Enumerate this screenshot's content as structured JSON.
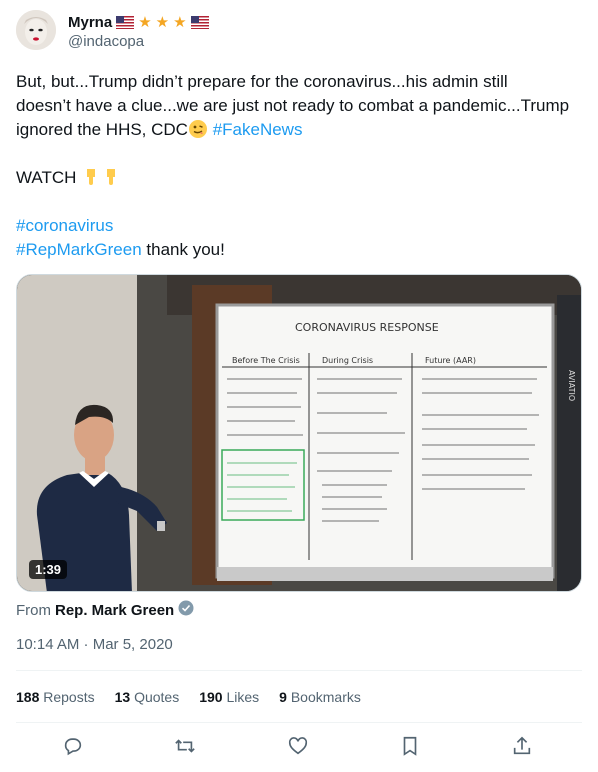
{
  "author": {
    "name": "Myrna",
    "handle": "@indacopa"
  },
  "tweet": {
    "line1": "But, but...Trump didn’t prepare for the coronavirus...his admin still",
    "line2": "doesn’t have a clue...we are just not ready to combat a pandemic...Trump",
    "line3_pre": "ignored the HHS, CDC",
    "hashtag_fakenews": "#FakeNews",
    "watch": "WATCH",
    "hashtag_coronavirus": "#coronavirus",
    "hashtag_repmarkgreen": "#RepMarkGreen",
    "thanks": " thank you!"
  },
  "media": {
    "duration": "1:39",
    "whiteboard": {
      "heading": "CORONAVIRUS RESPONSE",
      "col1": "Before The Crisis",
      "col2": "During Crisis",
      "col3": "Future (AAR)",
      "side_text": "AVIATIO"
    }
  },
  "source": {
    "prefix": "From ",
    "name": "Rep. Mark Green"
  },
  "timestamp": "10:14 AM · Mar 5, 2020",
  "stats": {
    "reposts_count": "188",
    "reposts_label": "Reposts",
    "quotes_count": "13",
    "quotes_label": "Quotes",
    "likes_count": "190",
    "likes_label": "Likes",
    "bookmarks_count": "9",
    "bookmarks_label": "Bookmarks"
  },
  "colors": {
    "link": "#1d9bf0",
    "secondary_text": "#536471",
    "star": "#f4a623"
  },
  "icons": [
    "us-flag-icon",
    "star-icon",
    "verified-badge-icon",
    "reply-icon",
    "repost-icon",
    "like-icon",
    "bookmark-icon",
    "share-icon",
    "face-emoji-icon",
    "pointing-down-emoji-icon"
  ]
}
